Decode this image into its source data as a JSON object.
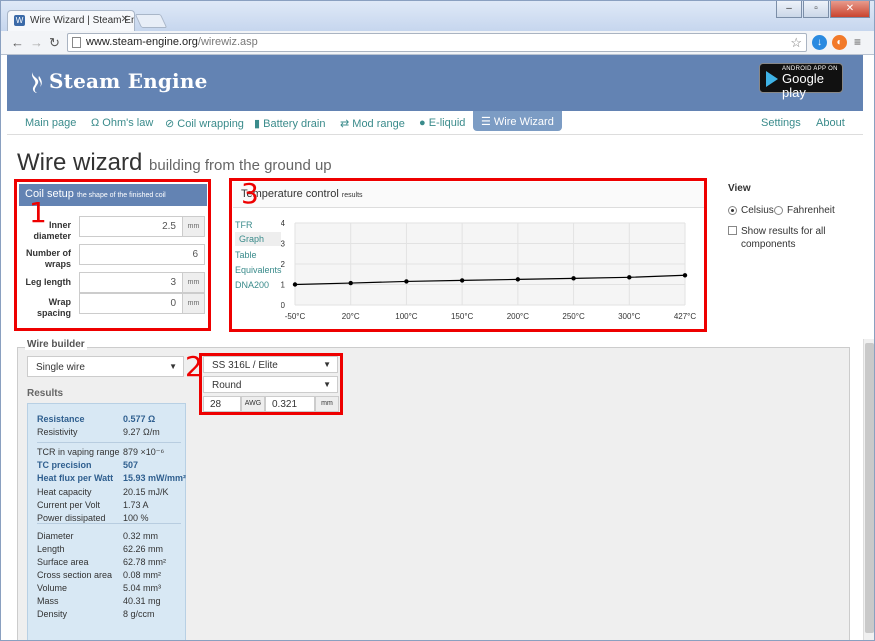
{
  "browser": {
    "tab_title": "Wire Wizard | Steam Eng",
    "url_domain": "www.steam-engine.org",
    "url_path": "/wirewiz.asp"
  },
  "site": {
    "logo_text": "Steam Engine",
    "store_badge_top": "ANDROID APP ON",
    "store_badge_main": "Google play"
  },
  "nav": {
    "items": [
      "Main page",
      "Ohm's law",
      "Coil wrapping",
      "Battery drain",
      "Mod range",
      "E-liquid",
      "Wire Wizard"
    ],
    "right": [
      "Settings",
      "About"
    ],
    "active": "Wire Wizard"
  },
  "page": {
    "title": "Wire wizard",
    "subtitle": "building from the ground up"
  },
  "coil_setup": {
    "title": "Coil setup",
    "subtitle": "the shape of the finished coil",
    "fields": [
      {
        "label_1": "Inner",
        "label_2": "diameter",
        "value": "2.5",
        "unit": "mm"
      },
      {
        "label_1": "Number of",
        "label_2": "wraps",
        "value": "6",
        "unit": ""
      },
      {
        "label_1": "Leg length",
        "label_2": "",
        "value": "3",
        "unit": "mm"
      },
      {
        "label_1": "Wrap",
        "label_2": "spacing",
        "value": "0",
        "unit": "mm"
      }
    ]
  },
  "temperature": {
    "title": "Temperature control",
    "subtitle": "results",
    "links": [
      "TFR",
      "Graph",
      "Table",
      "Equivalents",
      "DNA200"
    ],
    "active": "Graph"
  },
  "chart_data": {
    "type": "line",
    "categories": [
      "-50°C",
      "20°C",
      "100°C",
      "150°C",
      "200°C",
      "250°C",
      "300°C",
      "427°C"
    ],
    "values": [
      1.0,
      1.07,
      1.15,
      1.2,
      1.25,
      1.3,
      1.35,
      1.45
    ],
    "ylim": [
      0,
      4
    ],
    "yticks": [
      "0",
      "1",
      "2",
      "3",
      "4"
    ],
    "grid": true,
    "color": "#000000"
  },
  "view": {
    "title": "View",
    "celsius": "Celsius",
    "fahrenheit": "Fahrenheit",
    "show_all": "Show results for all components",
    "show_all_1": "Show results for all",
    "show_all_2": "components"
  },
  "builder": {
    "title": "Wire builder",
    "wire_type": "Single wire",
    "material": "SS 316L / Elite",
    "shape": "Round",
    "gauge": "28",
    "gauge_unit": "AWG",
    "diameter": "0.321",
    "diameter_unit": "mm"
  },
  "results": {
    "title": "Results",
    "rows": [
      {
        "k": "Resistance",
        "v": "0.577 Ω",
        "bold": true
      },
      {
        "k": "Resistivity",
        "v": "9.27 Ω/m",
        "bold": false
      },
      {
        "k": "TCR in vaping range",
        "v": "879 ×10⁻⁶",
        "bold": false
      },
      {
        "k": "TC precision",
        "v": "507",
        "bold": true
      },
      {
        "k": "Heat flux per Watt",
        "v": "15.93 mW/mm²",
        "bold": true
      },
      {
        "k": "Heat capacity",
        "v": "20.15 mJ/K",
        "bold": false
      },
      {
        "k": "Current per Volt",
        "v": "1.73 A",
        "bold": false
      },
      {
        "k": "Power dissipated",
        "v": "100 %",
        "bold": false
      },
      {
        "k": "Diameter",
        "v": "0.32 mm",
        "bold": false
      },
      {
        "k": "Length",
        "v": "62.26 mm",
        "bold": false
      },
      {
        "k": "Surface area",
        "v": "62.78 mm²",
        "bold": false
      },
      {
        "k": "Cross section area",
        "v": "0.08 mm²",
        "bold": false
      },
      {
        "k": "Volume",
        "v": "5.04 mm³",
        "bold": false
      },
      {
        "k": "Mass",
        "v": "40.31 mg",
        "bold": false
      },
      {
        "k": "Density",
        "v": "8 g/ccm",
        "bold": false
      }
    ]
  },
  "annotations": [
    "1",
    "2",
    "3"
  ],
  "colors": {
    "accent": "#6383b3",
    "link": "#3a8b8b",
    "highlight": "#e00000"
  }
}
